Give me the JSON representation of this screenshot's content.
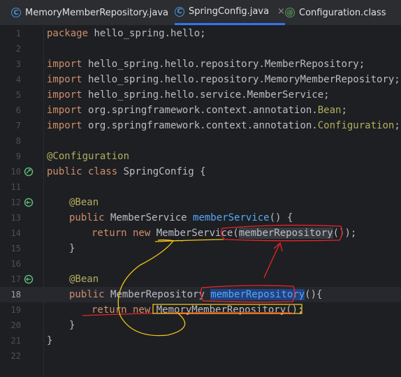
{
  "tabs": [
    {
      "label": "MemoryMemberRepository.java",
      "icon": "java-class-icon",
      "active": false,
      "closable": false
    },
    {
      "label": "SpringConfig.java",
      "icon": "java-class-icon",
      "active": true,
      "closable": true,
      "close_glyph": "×"
    },
    {
      "label": "Configuration.class",
      "icon": "annotation-class-icon",
      "active": false,
      "closable": false
    }
  ],
  "line_numbers": [
    "1",
    "2",
    "3",
    "4",
    "5",
    "6",
    "7",
    "8",
    "9",
    "10",
    "11",
    "12",
    "13",
    "14",
    "15",
    "16",
    "17",
    "18",
    "19",
    "20",
    "21",
    "22"
  ],
  "code": {
    "l1_kw": "package",
    "l1_rest": " hello_spring.hello;",
    "import_kw": "import",
    "l3_rest": " hello_spring.hello.repository.MemberRepository;",
    "l4_rest": " hello_spring.hello.repository.MemoryMemberRepository;",
    "l5_rest": " hello_spring.hello.service.MemberService;",
    "l6_a": " org.springframework.context.annotation.",
    "l6_b": "Bean",
    "l6_c": ";",
    "l7_a": " org.springframework.context.annotation.",
    "l7_b": "Configuration",
    "l7_c": ";",
    "l9_ann": "@Configuration",
    "l10_kw": "public class",
    "l10_rest": " SpringConfig {",
    "bean_ann": "@Bean",
    "public_kw": "public",
    "l13_type": " MemberService ",
    "l13_fn": "memberService",
    "l13_rest": "() {",
    "l14_kw": "return new",
    "l14_a": " MemberService(",
    "l14_b": "memberRepository",
    "l14_c": "());",
    "close_brace": "}",
    "l18_type": " MemberRepository ",
    "l18_fn": "memberRepository",
    "l18_rest": "(){",
    "l19_kw": "return new",
    "l19_rest": " MemoryMemberRepository();"
  },
  "colors": {
    "keyword": "#cf8e6d",
    "annotation": "#b3ae60",
    "function": "#56a8f5",
    "text": "#bcbec4",
    "red_ink": "#e8262a",
    "yellow_ink": "#f5c518"
  }
}
